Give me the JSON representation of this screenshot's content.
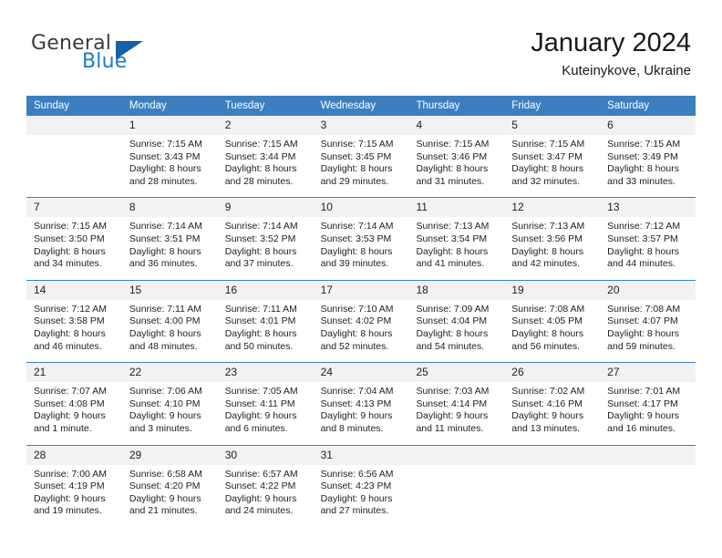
{
  "brand": {
    "name_part1": "General",
    "name_part2": "Blue",
    "triangle_icon": "blue-triangle-icon",
    "accent_color": "#1560a8"
  },
  "header": {
    "title": "January 2024",
    "location": "Kuteinykove, Ukraine"
  },
  "calendar": {
    "header_bg": "#3c7fc0",
    "daynum_bg": "#f2f2f2",
    "weekdays": [
      "Sunday",
      "Monday",
      "Tuesday",
      "Wednesday",
      "Thursday",
      "Friday",
      "Saturday"
    ],
    "weeks": [
      [
        {
          "day": "",
          "lines": [
            "",
            "",
            "",
            ""
          ]
        },
        {
          "day": "1",
          "lines": [
            "Sunrise: 7:15 AM",
            "Sunset: 3:43 PM",
            "Daylight: 8 hours",
            "and 28 minutes."
          ]
        },
        {
          "day": "2",
          "lines": [
            "Sunrise: 7:15 AM",
            "Sunset: 3:44 PM",
            "Daylight: 8 hours",
            "and 28 minutes."
          ]
        },
        {
          "day": "3",
          "lines": [
            "Sunrise: 7:15 AM",
            "Sunset: 3:45 PM",
            "Daylight: 8 hours",
            "and 29 minutes."
          ]
        },
        {
          "day": "4",
          "lines": [
            "Sunrise: 7:15 AM",
            "Sunset: 3:46 PM",
            "Daylight: 8 hours",
            "and 31 minutes."
          ]
        },
        {
          "day": "5",
          "lines": [
            "Sunrise: 7:15 AM",
            "Sunset: 3:47 PM",
            "Daylight: 8 hours",
            "and 32 minutes."
          ]
        },
        {
          "day": "6",
          "lines": [
            "Sunrise: 7:15 AM",
            "Sunset: 3:49 PM",
            "Daylight: 8 hours",
            "and 33 minutes."
          ]
        }
      ],
      [
        {
          "day": "7",
          "lines": [
            "Sunrise: 7:15 AM",
            "Sunset: 3:50 PM",
            "Daylight: 8 hours",
            "and 34 minutes."
          ]
        },
        {
          "day": "8",
          "lines": [
            "Sunrise: 7:14 AM",
            "Sunset: 3:51 PM",
            "Daylight: 8 hours",
            "and 36 minutes."
          ]
        },
        {
          "day": "9",
          "lines": [
            "Sunrise: 7:14 AM",
            "Sunset: 3:52 PM",
            "Daylight: 8 hours",
            "and 37 minutes."
          ]
        },
        {
          "day": "10",
          "lines": [
            "Sunrise: 7:14 AM",
            "Sunset: 3:53 PM",
            "Daylight: 8 hours",
            "and 39 minutes."
          ]
        },
        {
          "day": "11",
          "lines": [
            "Sunrise: 7:13 AM",
            "Sunset: 3:54 PM",
            "Daylight: 8 hours",
            "and 41 minutes."
          ]
        },
        {
          "day": "12",
          "lines": [
            "Sunrise: 7:13 AM",
            "Sunset: 3:56 PM",
            "Daylight: 8 hours",
            "and 42 minutes."
          ]
        },
        {
          "day": "13",
          "lines": [
            "Sunrise: 7:12 AM",
            "Sunset: 3:57 PM",
            "Daylight: 8 hours",
            "and 44 minutes."
          ]
        }
      ],
      [
        {
          "day": "14",
          "lines": [
            "Sunrise: 7:12 AM",
            "Sunset: 3:58 PM",
            "Daylight: 8 hours",
            "and 46 minutes."
          ]
        },
        {
          "day": "15",
          "lines": [
            "Sunrise: 7:11 AM",
            "Sunset: 4:00 PM",
            "Daylight: 8 hours",
            "and 48 minutes."
          ]
        },
        {
          "day": "16",
          "lines": [
            "Sunrise: 7:11 AM",
            "Sunset: 4:01 PM",
            "Daylight: 8 hours",
            "and 50 minutes."
          ]
        },
        {
          "day": "17",
          "lines": [
            "Sunrise: 7:10 AM",
            "Sunset: 4:02 PM",
            "Daylight: 8 hours",
            "and 52 minutes."
          ]
        },
        {
          "day": "18",
          "lines": [
            "Sunrise: 7:09 AM",
            "Sunset: 4:04 PM",
            "Daylight: 8 hours",
            "and 54 minutes."
          ]
        },
        {
          "day": "19",
          "lines": [
            "Sunrise: 7:08 AM",
            "Sunset: 4:05 PM",
            "Daylight: 8 hours",
            "and 56 minutes."
          ]
        },
        {
          "day": "20",
          "lines": [
            "Sunrise: 7:08 AM",
            "Sunset: 4:07 PM",
            "Daylight: 8 hours",
            "and 59 minutes."
          ]
        }
      ],
      [
        {
          "day": "21",
          "lines": [
            "Sunrise: 7:07 AM",
            "Sunset: 4:08 PM",
            "Daylight: 9 hours",
            "and 1 minute."
          ]
        },
        {
          "day": "22",
          "lines": [
            "Sunrise: 7:06 AM",
            "Sunset: 4:10 PM",
            "Daylight: 9 hours",
            "and 3 minutes."
          ]
        },
        {
          "day": "23",
          "lines": [
            "Sunrise: 7:05 AM",
            "Sunset: 4:11 PM",
            "Daylight: 9 hours",
            "and 6 minutes."
          ]
        },
        {
          "day": "24",
          "lines": [
            "Sunrise: 7:04 AM",
            "Sunset: 4:13 PM",
            "Daylight: 9 hours",
            "and 8 minutes."
          ]
        },
        {
          "day": "25",
          "lines": [
            "Sunrise: 7:03 AM",
            "Sunset: 4:14 PM",
            "Daylight: 9 hours",
            "and 11 minutes."
          ]
        },
        {
          "day": "26",
          "lines": [
            "Sunrise: 7:02 AM",
            "Sunset: 4:16 PM",
            "Daylight: 9 hours",
            "and 13 minutes."
          ]
        },
        {
          "day": "27",
          "lines": [
            "Sunrise: 7:01 AM",
            "Sunset: 4:17 PM",
            "Daylight: 9 hours",
            "and 16 minutes."
          ]
        }
      ],
      [
        {
          "day": "28",
          "lines": [
            "Sunrise: 7:00 AM",
            "Sunset: 4:19 PM",
            "Daylight: 9 hours",
            "and 19 minutes."
          ]
        },
        {
          "day": "29",
          "lines": [
            "Sunrise: 6:58 AM",
            "Sunset: 4:20 PM",
            "Daylight: 9 hours",
            "and 21 minutes."
          ]
        },
        {
          "day": "30",
          "lines": [
            "Sunrise: 6:57 AM",
            "Sunset: 4:22 PM",
            "Daylight: 9 hours",
            "and 24 minutes."
          ]
        },
        {
          "day": "31",
          "lines": [
            "Sunrise: 6:56 AM",
            "Sunset: 4:23 PM",
            "Daylight: 9 hours",
            "and 27 minutes."
          ]
        },
        {
          "day": "",
          "lines": [
            "",
            "",
            "",
            ""
          ]
        },
        {
          "day": "",
          "lines": [
            "",
            "",
            "",
            ""
          ]
        },
        {
          "day": "",
          "lines": [
            "",
            "",
            "",
            ""
          ]
        }
      ]
    ]
  }
}
